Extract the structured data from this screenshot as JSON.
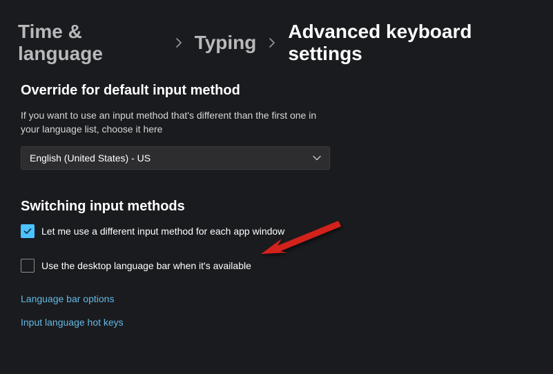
{
  "breadcrumb": {
    "parent1": "Time & language",
    "parent2": "Typing",
    "current": "Advanced keyboard settings"
  },
  "sections": {
    "override": {
      "heading": "Override for default input method",
      "desc": "If you want to use an input method that's different than the first one in your language list, choose it here",
      "select_value": "English (United States) - US"
    },
    "switching": {
      "heading": "Switching input methods",
      "checkbox1": {
        "label": "Let me use a different input method for each app window",
        "checked": true
      },
      "checkbox2": {
        "label": "Use the desktop language bar when it's available",
        "checked": false
      }
    }
  },
  "links": {
    "language_bar": "Language bar options",
    "hotkeys": "Input language hot keys"
  },
  "colors": {
    "accent": "#4cc2ff",
    "link": "#63b9e6",
    "bg": "#1a1b1e",
    "arrow": "#d3221f"
  }
}
